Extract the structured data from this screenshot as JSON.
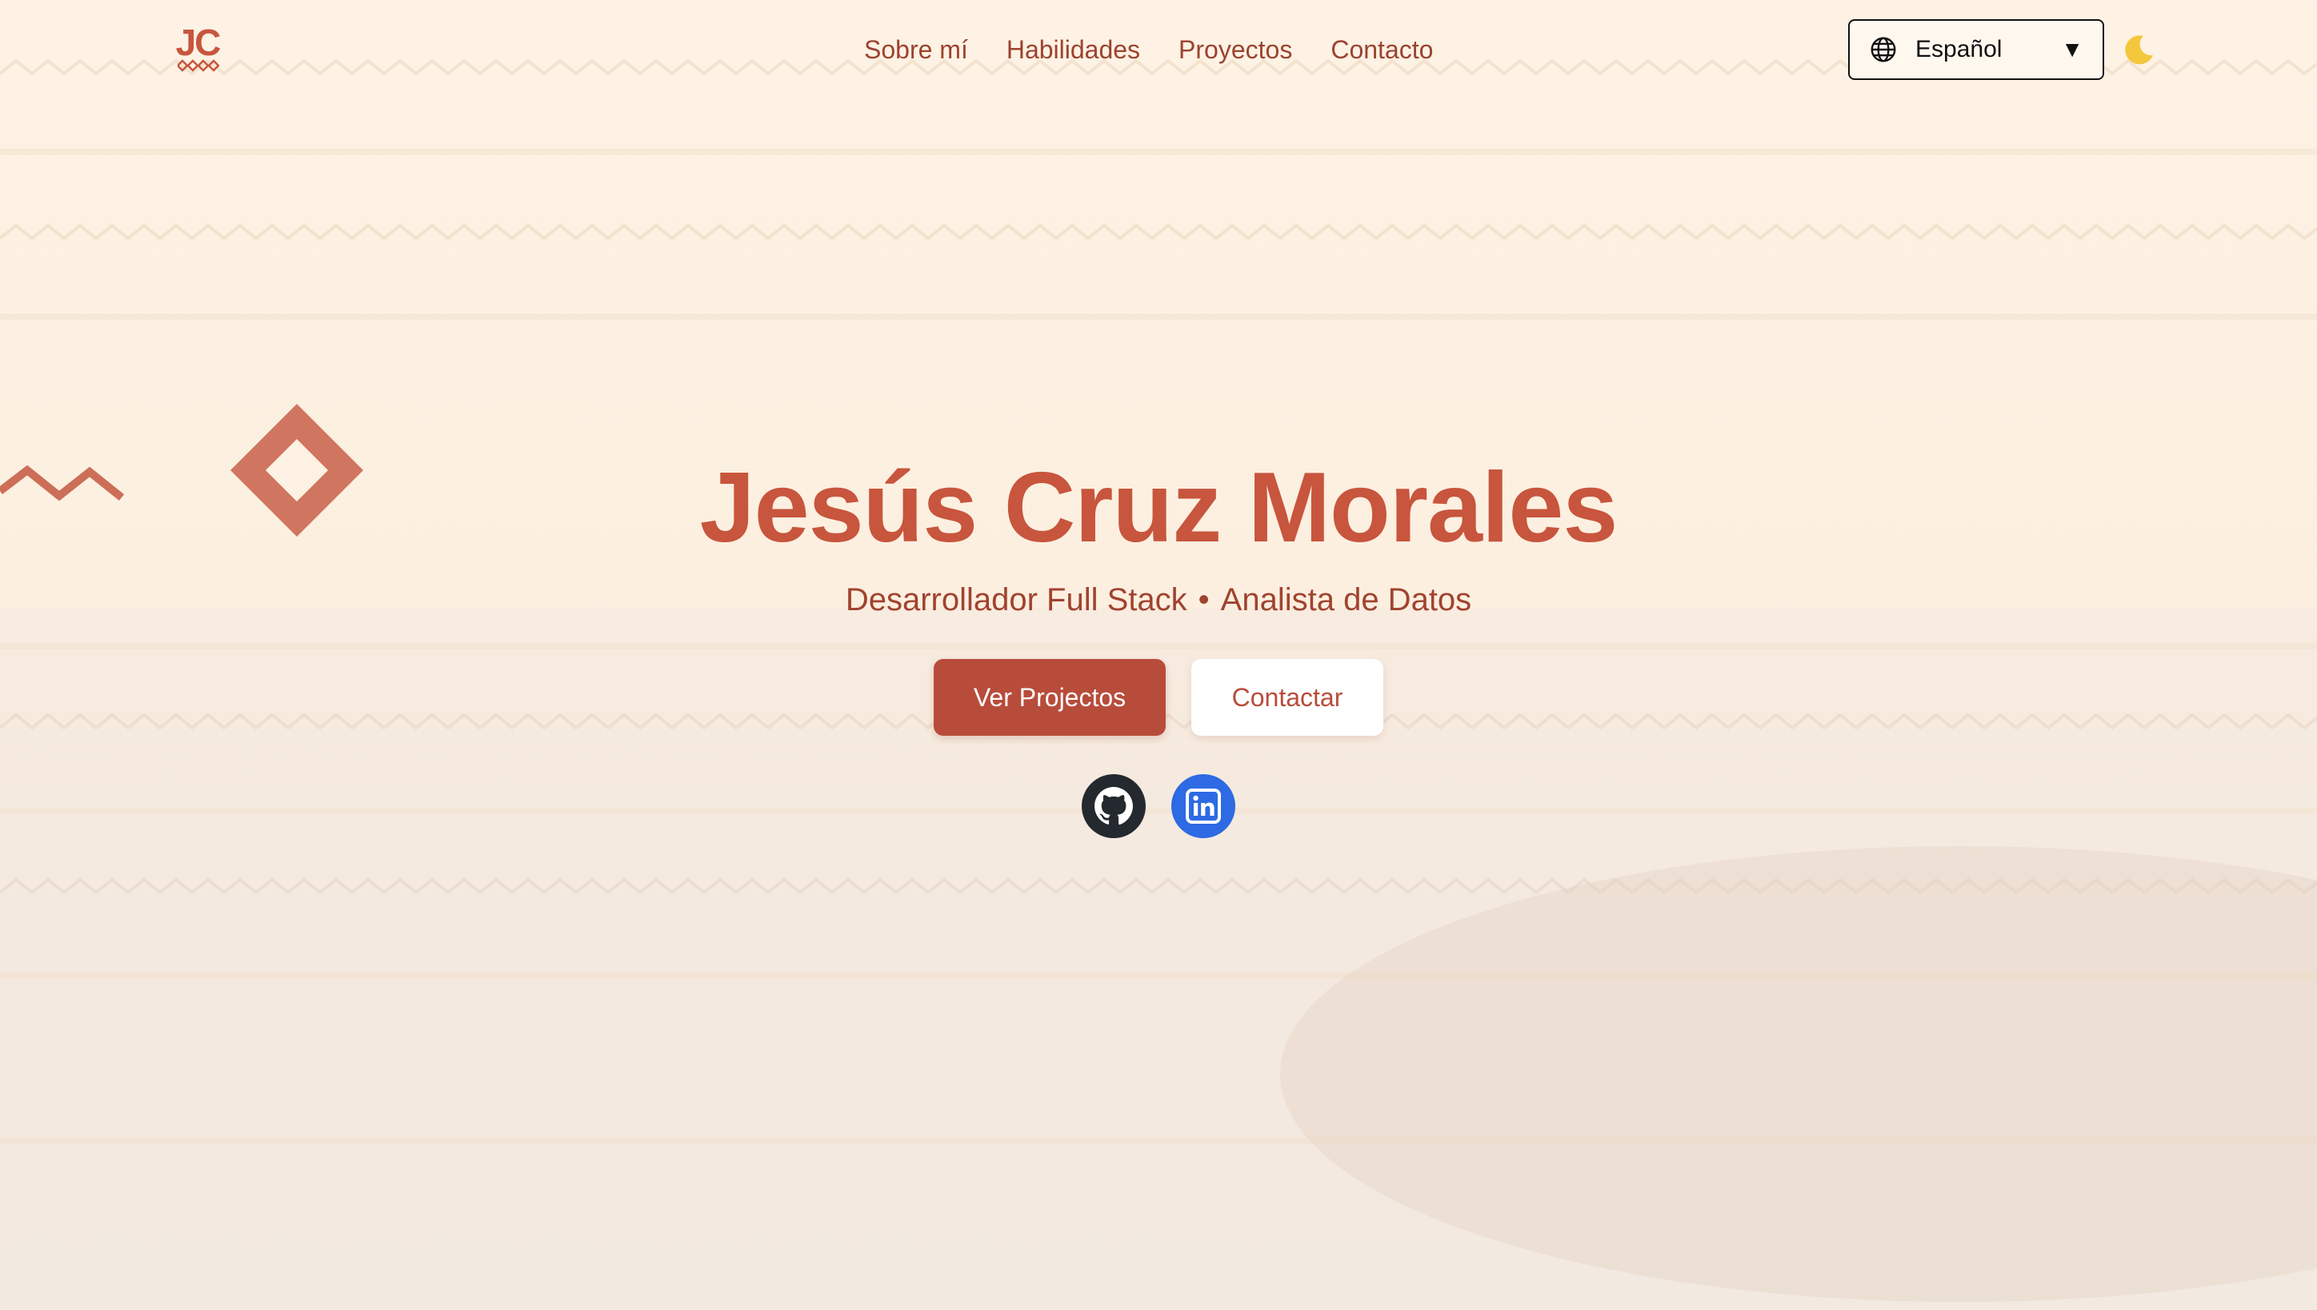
{
  "brand": {
    "logo_text": "JC",
    "accent_color": "#c8553d"
  },
  "nav": {
    "items": [
      {
        "label": "Sobre mí"
      },
      {
        "label": "Habilidades"
      },
      {
        "label": "Proyectos"
      },
      {
        "label": "Contacto"
      }
    ]
  },
  "language_selector": {
    "selected": "Español",
    "icon": "globe-icon",
    "caret": "▼"
  },
  "theme_toggle": {
    "icon": "moon-icon"
  },
  "hero": {
    "name": "Jesús Cruz Morales",
    "role_1": "Desarrollador Full Stack",
    "separator": "•",
    "role_2": "Analista de Datos",
    "primary_button": "Ver Projectos",
    "secondary_button": "Contactar",
    "primary_color": "#b84c3b"
  },
  "social": [
    {
      "icon": "github-icon",
      "color": "#24292f"
    },
    {
      "icon": "linkedin-icon",
      "color": "#2d6ae3"
    }
  ]
}
